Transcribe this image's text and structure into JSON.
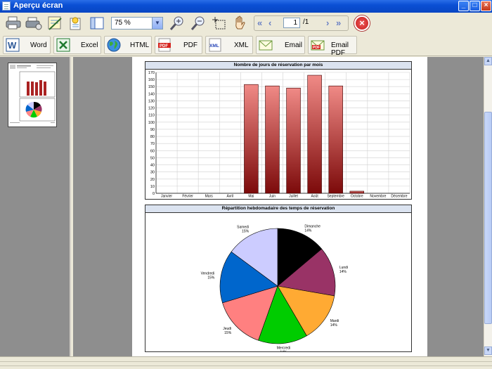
{
  "window": {
    "title": "Aperçu écran",
    "min": "_",
    "max": "□",
    "close": "×"
  },
  "toolbar": {
    "zoom_value": "75 %",
    "page_current": "1",
    "page_total": "/1"
  },
  "export_buttons": [
    {
      "label": "Word",
      "icon": "word-icon"
    },
    {
      "label": "Excel",
      "icon": "excel-icon"
    },
    {
      "label": "HTML",
      "icon": "html-globe-icon"
    },
    {
      "label": "PDF",
      "icon": "pdf-icon"
    },
    {
      "label": "XML",
      "icon": "xml-icon"
    },
    {
      "label": "Email",
      "icon": "email-icon"
    },
    {
      "label": "Email PDF",
      "icon": "email-pdf-icon"
    }
  ],
  "icon_texts": {
    "pdf": "PDF",
    "xml": "XML"
  },
  "colors": {
    "titlebar": "#0a4fd4",
    "bar_top": "#f08a86",
    "bar_bottom": "#7c0a0a",
    "viewer_bg": "#8e8e8e"
  },
  "chart_data": [
    {
      "type": "bar",
      "title": "Nombre de jours de réservation par mois",
      "categories": [
        "Janvier",
        "Février",
        "Mars",
        "Avril",
        "Mai",
        "Juin",
        "Juillet",
        "Août",
        "Septembre",
        "Octobre",
        "Novembre",
        "Décembre"
      ],
      "values": [
        0,
        0,
        0,
        0,
        153,
        151,
        148,
        166,
        151,
        3,
        0,
        0
      ],
      "ylim": [
        0,
        170
      ],
      "yticks": [
        0,
        10,
        20,
        30,
        40,
        50,
        60,
        70,
        80,
        90,
        100,
        110,
        120,
        130,
        140,
        150,
        160,
        170
      ],
      "grid": true
    },
    {
      "type": "pie",
      "title": "Répartition hebdomadaire des temps de réservation",
      "slices": [
        {
          "label": "Dimanche",
          "pct": "14%",
          "value": 14,
          "color": "#000000"
        },
        {
          "label": "Lundi",
          "pct": "14%",
          "value": 14,
          "color": "#993366"
        },
        {
          "label": "Mardi",
          "pct": "14%",
          "value": 14,
          "color": "#ffaa33"
        },
        {
          "label": "Mercredi",
          "pct": "14%",
          "value": 14,
          "color": "#00cc00"
        },
        {
          "label": "Jeudi",
          "pct": "15%",
          "value": 15,
          "color": "#ff8080"
        },
        {
          "label": "Vendredi",
          "pct": "15%",
          "value": 15,
          "color": "#0066cc"
        },
        {
          "label": "Samedi",
          "pct": "15%",
          "value": 15,
          "color": "#ccccff"
        }
      ]
    }
  ]
}
